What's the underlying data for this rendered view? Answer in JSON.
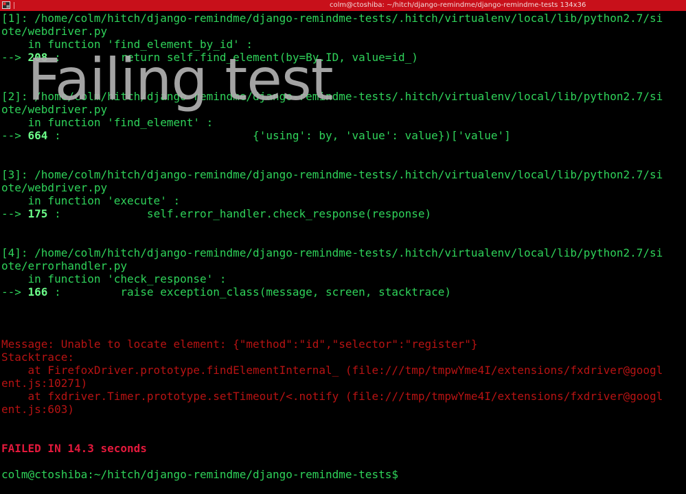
{
  "window": {
    "title": "colm@ctoshiba: ~/hitch/django-remindme/django-remindme-tests 134x36",
    "icon": "terminal-icon"
  },
  "caption": "Failing test",
  "frames": [
    {
      "header": "[1]: /home/colm/hitch/django-remindme/django-remindme-tests/.hitch/virtualenv/local/lib/python2.7/si",
      "header_cont": "ote/webdriver.py",
      "function": "    in function 'find_element_by_id' :",
      "arrow": "--> ",
      "lineno": "208",
      "code": " :         return self.find_element(by=By.ID, value=id_)"
    },
    {
      "header": "[2]: /home/colm/hitch/django-remindme/django-remindme-tests/.hitch/virtualenv/local/lib/python2.7/si",
      "header_cont": "ote/webdriver.py",
      "function": "    in function 'find_element' :",
      "arrow": "--> ",
      "lineno": "664",
      "code": " :                             {'using': by, 'value': value})['value']"
    },
    {
      "header": "[3]: /home/colm/hitch/django-remindme/django-remindme-tests/.hitch/virtualenv/local/lib/python2.7/si",
      "header_cont": "ote/webdriver.py",
      "function": "    in function 'execute' :",
      "arrow": "--> ",
      "lineno": "175",
      "code": " :             self.error_handler.check_response(response)"
    },
    {
      "header": "[4]: /home/colm/hitch/django-remindme/django-remindme-tests/.hitch/virtualenv/local/lib/python2.7/si",
      "header_cont": "ote/errorhandler.py",
      "function": "    in function 'check_response' :",
      "arrow": "--> ",
      "lineno": "166",
      "code": " :         raise exception_class(message, screen, stacktrace)"
    }
  ],
  "error": {
    "message": "Message: Unable to locate element: {\"method\":\"id\",\"selector\":\"register\"}",
    "stacktrace_label": "Stacktrace:",
    "stack1": "    at FirefoxDriver.prototype.findElementInternal_ (file:///tmp/tmpwYme4I/extensions/fxdriver@googl",
    "stack1_cont": "ent.js:10271)",
    "stack2": "    at fxdriver.Timer.prototype.setTimeout/<.notify (file:///tmp/tmpwYme4I/extensions/fxdriver@googl",
    "stack2_cont": "ent.js:603)"
  },
  "result": "FAILED IN 14.3 seconds",
  "prompt": "colm@ctoshiba:~/hitch/django-remindme/django-remindme-tests$ ",
  "colors": {
    "titlebar": "#c8101a",
    "text_green": "#2fd35a",
    "error_red": "#b81313",
    "failed_red": "#e3193c",
    "background": "#000000"
  }
}
